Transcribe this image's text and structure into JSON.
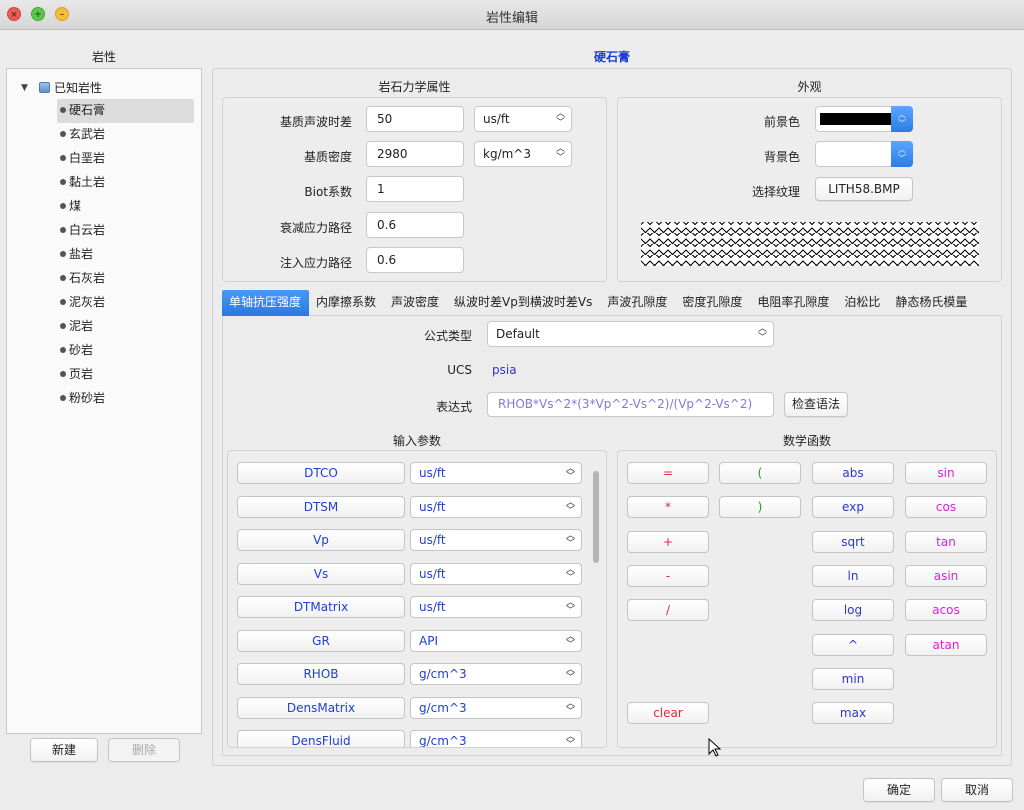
{
  "window": {
    "title": "岩性编辑"
  },
  "left": {
    "title": "岩性",
    "root_label": "已知岩性",
    "items": [
      "硬石膏",
      "玄武岩",
      "白垩岩",
      "黏土岩",
      "煤",
      "白云岩",
      "盐岩",
      "石灰岩",
      "泥灰岩",
      "泥岩",
      "砂岩",
      "页岩",
      "粉砂岩"
    ],
    "selected_index": 0,
    "new_button": "新建",
    "delete_button": "删除"
  },
  "rock_name": "硬石膏",
  "mechanics": {
    "title": "岩石力学属性",
    "rows": [
      {
        "label": "基质声波时差",
        "value": "50",
        "unit": "us/ft"
      },
      {
        "label": "基质密度",
        "value": "2980",
        "unit": "kg/m^3"
      },
      {
        "label": "Biot系数",
        "value": "1"
      },
      {
        "label": "衰减应力路径",
        "value": "0.6"
      },
      {
        "label": "注入应力路径",
        "value": "0.6"
      }
    ]
  },
  "appearance": {
    "title": "外观",
    "foreground_label": "前景色",
    "foreground_color": "#000000",
    "background_label": "背景色",
    "background_color": "#ffffff",
    "texture_label": "选择纹理",
    "texture_button": "LITH58.BMP"
  },
  "tabs": [
    "单轴抗压强度",
    "内摩擦系数",
    "声波密度",
    "纵波时差Vp到横波时差Vs",
    "声波孔隙度",
    "密度孔隙度",
    "电阻率孔隙度",
    "泊松比",
    "静态杨氏模量"
  ],
  "active_tab": 0,
  "formula": {
    "type_label": "公式类型",
    "type_value": "Default",
    "ucs_label": "UCS",
    "ucs_value": "psia",
    "expr_label": "表达式",
    "expr_value": "RHOB*Vs^2*(3*Vp^2-Vs^2)/(Vp^2-Vs^2)",
    "check_button": "检查语法"
  },
  "input_params": {
    "title": "输入参数",
    "rows": [
      {
        "name": "DTCO",
        "unit": "us/ft"
      },
      {
        "name": "DTSM",
        "unit": "us/ft"
      },
      {
        "name": "Vp",
        "unit": "us/ft"
      },
      {
        "name": "Vs",
        "unit": "us/ft"
      },
      {
        "name": "DTMatrix",
        "unit": "us/ft"
      },
      {
        "name": "GR",
        "unit": "API"
      },
      {
        "name": "RHOB",
        "unit": "g/cm^3"
      },
      {
        "name": "DensMatrix",
        "unit": "g/cm^3"
      },
      {
        "name": "DensFluid",
        "unit": "g/cm^3"
      }
    ]
  },
  "math": {
    "title": "数学函数",
    "operators": [
      "=",
      "*",
      "+",
      "-",
      "/"
    ],
    "parens": [
      "(",
      ")"
    ],
    "functions": [
      "abs",
      "exp",
      "sqrt",
      "ln",
      "log",
      "^",
      "min",
      "max"
    ],
    "trig": [
      "sin",
      "cos",
      "tan",
      "asin",
      "acos",
      "atan"
    ],
    "clear": "clear"
  },
  "footer": {
    "ok": "确定",
    "cancel": "取消"
  }
}
